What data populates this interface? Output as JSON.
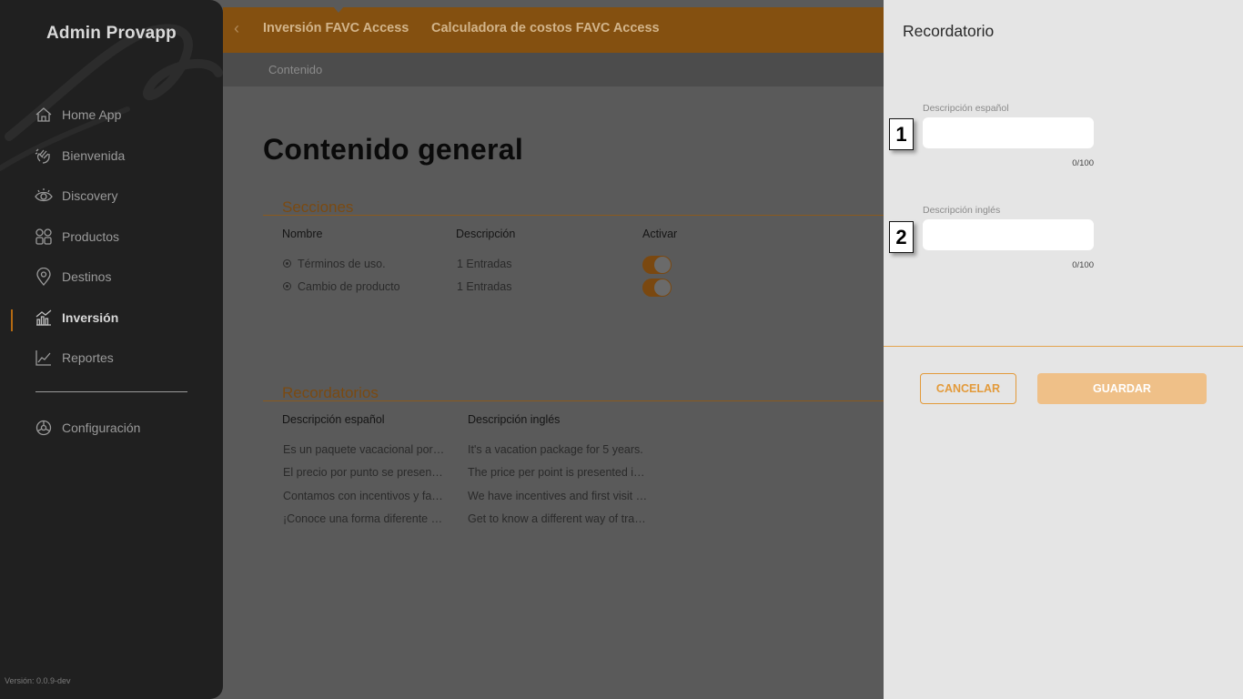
{
  "sidebar": {
    "brand": "Admin Provapp",
    "items": [
      {
        "label": "Home App",
        "icon": "home-icon"
      },
      {
        "label": "Bienvenida",
        "icon": "wave-hand-icon"
      },
      {
        "label": "Discovery",
        "icon": "eye-icon"
      },
      {
        "label": "Productos",
        "icon": "grid-icon"
      },
      {
        "label": "Destinos",
        "icon": "map-pin-icon"
      },
      {
        "label": "Inversión",
        "icon": "bar-chart-icon",
        "active": true
      },
      {
        "label": "Reportes",
        "icon": "line-chart-icon"
      }
    ],
    "settings": {
      "label": "Configuración",
      "icon": "gear-icon"
    },
    "version": "Versión: 0.0.9-dev"
  },
  "topbar": {
    "tabs": [
      "Inversión FAVC Access",
      "Calculadora de costos FAVC Access"
    ],
    "breadcrumb": "Contenido"
  },
  "main": {
    "title": "Contenido general",
    "sections": {
      "title": "Secciones",
      "columns": [
        "Nombre",
        "Descripción",
        "Activar"
      ],
      "rows": [
        {
          "name": "Términos de uso.",
          "description": "1 Entradas",
          "active": true
        },
        {
          "name": "Cambio de producto",
          "description": "1 Entradas",
          "active": true
        }
      ]
    },
    "reminders": {
      "title": "Recordatorios",
      "columns": [
        "Descripción español",
        "Descripción inglés"
      ],
      "rows": [
        {
          "es": "Es un paquete vacacional por…",
          "en": "It's a vacation package for 5 years."
        },
        {
          "es": "El precio por punto se presen…",
          "en": "The price per point is presented i…"
        },
        {
          "es": "Contamos con incentivos y fa…",
          "en": "We have incentives and first visit …"
        },
        {
          "es": "¡Conoce una forma diferente …",
          "en": "Get to know a different way of tra…"
        }
      ]
    }
  },
  "panel": {
    "title": "Recordatorio",
    "fields": [
      {
        "label": "Descripción español",
        "value": "",
        "counter": "0/100",
        "marker": "1"
      },
      {
        "label": "Descripción inglés",
        "value": "",
        "counter": "0/100",
        "marker": "2"
      }
    ],
    "cancel_label": "CANCELAR",
    "save_label": "GUARDAR"
  },
  "colors": {
    "accent": "#e39a3a",
    "topbar": "#845010",
    "sidebar": "#202020",
    "panel": "#e5e5e5"
  }
}
